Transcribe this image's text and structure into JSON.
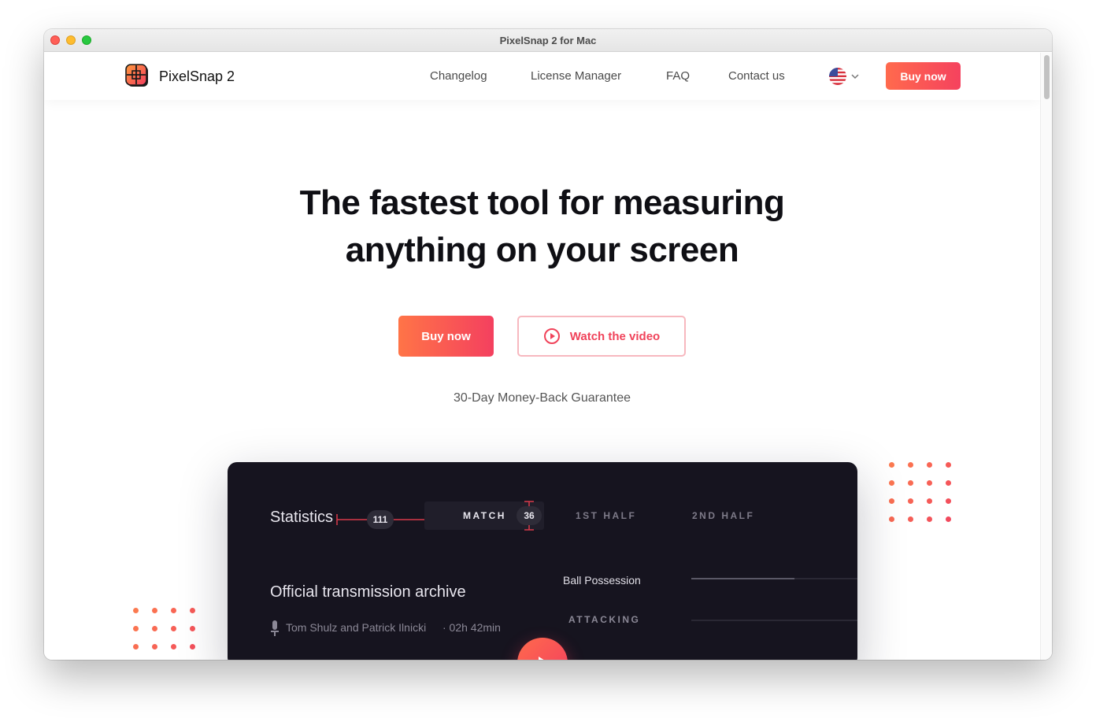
{
  "window": {
    "title": "PixelSnap 2 for Mac"
  },
  "nav": {
    "brand": "PixelSnap 2",
    "links": [
      "Changelog",
      "License Manager",
      "FAQ",
      "Contact us"
    ],
    "language_icon": "us-flag-icon",
    "buy_label": "Buy now"
  },
  "hero": {
    "title_line1": "The fastest tool for measuring",
    "title_line2": "anything on your screen",
    "primary_button": "Buy now",
    "video_button": "Watch the video",
    "guarantee": "30-Day Money-Back Guarantee"
  },
  "preview": {
    "statistics": "Statistics",
    "measure_width": "111",
    "measure_height": "36",
    "tabs": [
      "MATCH",
      "1ST HALF",
      "2ND HALF"
    ],
    "archive_title": "Official transmission archive",
    "authors": "Tom Shulz and Patrick Ilnicki",
    "duration": "· 02h 42min",
    "stat_label": "Ball Possession",
    "section_label": "ATTACKING"
  },
  "colors": {
    "accent_start": "#ff7447",
    "accent_end": "#f4405f",
    "dark_panel": "#16141f"
  }
}
